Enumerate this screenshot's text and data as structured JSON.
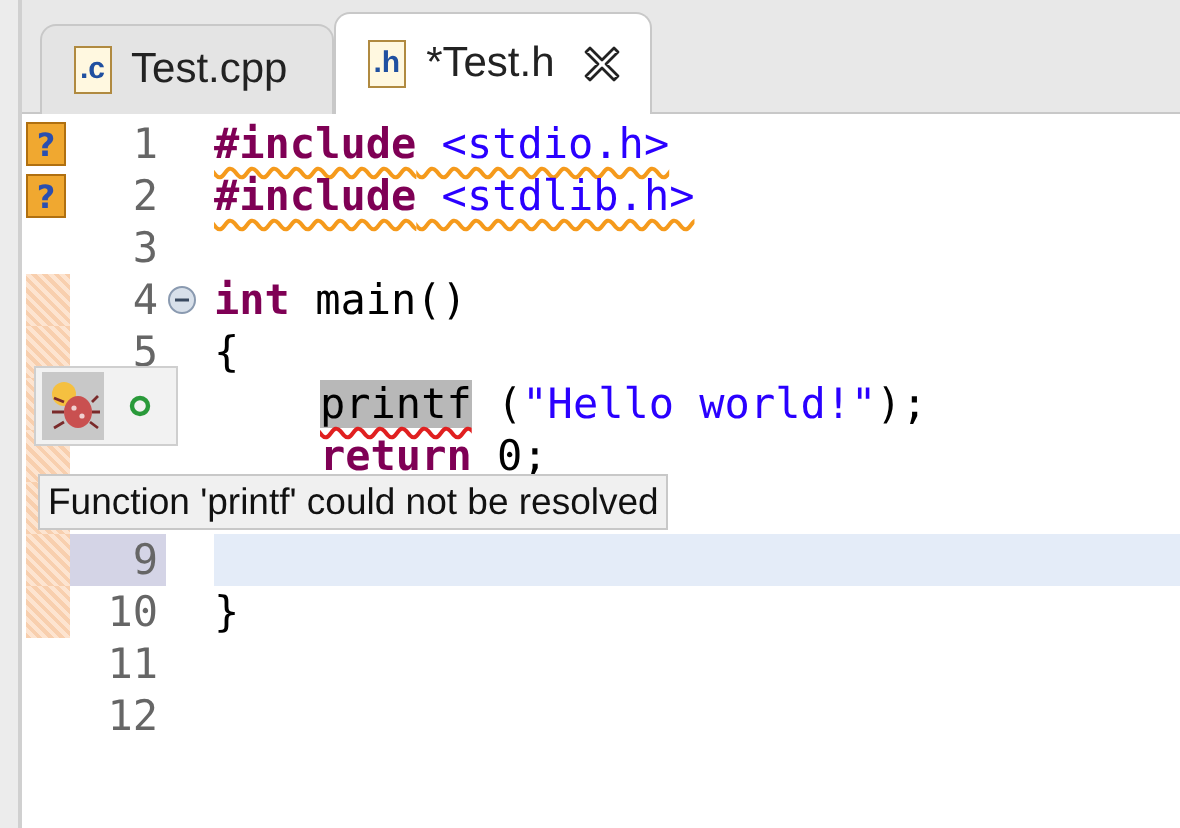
{
  "tabs": [
    {
      "label": "Test.cpp",
      "icon_text": ".c",
      "selected": false
    },
    {
      "label": "*Test.h",
      "icon_text": ".h",
      "selected": true,
      "close": true
    }
  ],
  "lines": [
    {
      "number": "1",
      "marker": {
        "kind": "warning",
        "glyph": "?"
      },
      "tokens": [
        {
          "text": "#include",
          "kind": "keyword",
          "warning_underline": true
        },
        {
          "text": " <stdio.h>",
          "kind": "string",
          "warning_underline": true
        }
      ]
    },
    {
      "number": "2",
      "marker": {
        "kind": "warning",
        "glyph": "?"
      },
      "tokens": [
        {
          "text": "#include",
          "kind": "keyword",
          "warning_underline": true
        },
        {
          "text": " <stdlib.h>",
          "kind": "string",
          "warning_underline": true
        }
      ]
    },
    {
      "number": "3"
    },
    {
      "number": "4",
      "annotated": true,
      "folded": false,
      "tokens": [
        {
          "text": "int",
          "kind": "keyword"
        },
        {
          "text": " main()",
          "kind": "plain"
        }
      ]
    },
    {
      "number": "5",
      "annotated": true,
      "tokens": [
        {
          "text": "{",
          "kind": "plain"
        }
      ]
    },
    {
      "annotated": true,
      "indented": true,
      "tokens": [
        {
          "text": "printf",
          "kind": "plain",
          "error_underline": true,
          "highlight": true
        },
        {
          "text": " (",
          "kind": "plain"
        },
        {
          "text": "\"Hello world!\"",
          "kind": "string"
        },
        {
          "text": ");",
          "kind": "plain"
        }
      ]
    },
    {
      "annotated": true,
      "indented": true,
      "tokens": [
        {
          "text": "return",
          "kind": "keyword"
        },
        {
          "text": " 0;",
          "kind": "plain"
        }
      ]
    },
    {
      "annotated": true
    },
    {
      "number": "9",
      "annotated": true,
      "current": true
    },
    {
      "number": "10",
      "annotated": true,
      "tokens": [
        {
          "text": "}",
          "kind": "plain"
        }
      ]
    },
    {
      "number": "11"
    },
    {
      "number": "12"
    }
  ],
  "quick_fix": {
    "items": [
      {
        "kind": "bug",
        "selected": true
      },
      {
        "kind": "dot",
        "selected": false
      }
    ]
  },
  "tooltip": "Function 'printf' could not be resolved"
}
